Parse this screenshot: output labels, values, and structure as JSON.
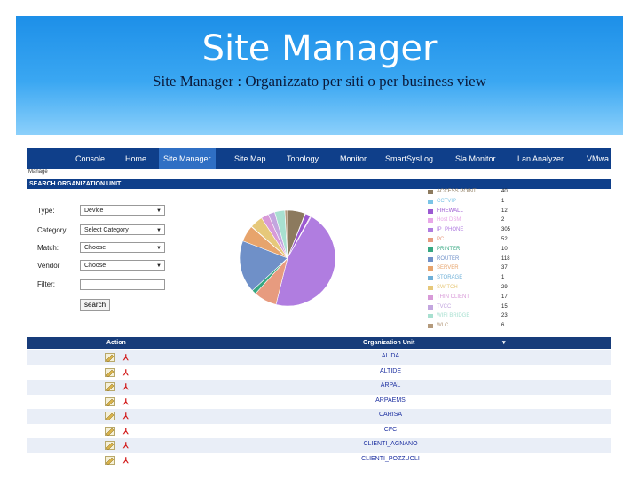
{
  "slide": {
    "title": "Site Manager",
    "subtitle": "Site Manager   : Organizzato per siti o per business view"
  },
  "nav": {
    "items": [
      "Console",
      "Home",
      "Site Manager",
      "Site Map",
      "Topology",
      "Monitor",
      "SmartSysLog",
      "Sla Monitor",
      "Lan Analyzer",
      "VMwa"
    ],
    "active": "Site Manager"
  },
  "breadcrumb": "Manage",
  "section_title": "SEARCH ORGANIZATION UNIT",
  "form": {
    "type_label": "Type:",
    "type_value": "Device",
    "category_label": "Category",
    "category_value": "Select Category",
    "match_label": "Match:",
    "match_value": "Choose",
    "vendor_label": "Vendor",
    "vendor_value": "Choose",
    "filter_label": "Filter:",
    "search_label": "search"
  },
  "chart_data": {
    "type": "pie",
    "categories": [
      "ACCESS POINT",
      "CCTVIP",
      "FIREWALL",
      "Host DSM",
      "IP_PHONE",
      "PC",
      "PRINTER",
      "ROUTER",
      "SERVER",
      "STORAGE",
      "SWITCH",
      "THIN CLIENT",
      "TVCC",
      "WIFI BRIDGE",
      "WLC"
    ],
    "values": [
      40,
      1,
      12,
      2,
      305,
      52,
      10,
      118,
      37,
      1,
      29,
      17,
      15,
      23,
      6
    ],
    "colors": [
      "#8c7a5e",
      "#7ac4e6",
      "#9b59d1",
      "#e8a7e8",
      "#b07de0",
      "#e79b7f",
      "#37a882",
      "#6f90c8",
      "#e7a46c",
      "#6fb0d8",
      "#e6c87a",
      "#d89ad8",
      "#c3a6df",
      "#a8e0d0",
      "#b49a7c"
    ]
  },
  "table": {
    "action_header": "Action",
    "org_header": "Organization Unit",
    "sort_glyph": "▾",
    "rows": [
      "ALIDA",
      "ALTIDE",
      "ARPAL",
      "ARPAEMS",
      "CARISA",
      "CFC",
      "CLIENTI_AGNANO",
      "CLIENTI_POZZUOLI"
    ]
  }
}
